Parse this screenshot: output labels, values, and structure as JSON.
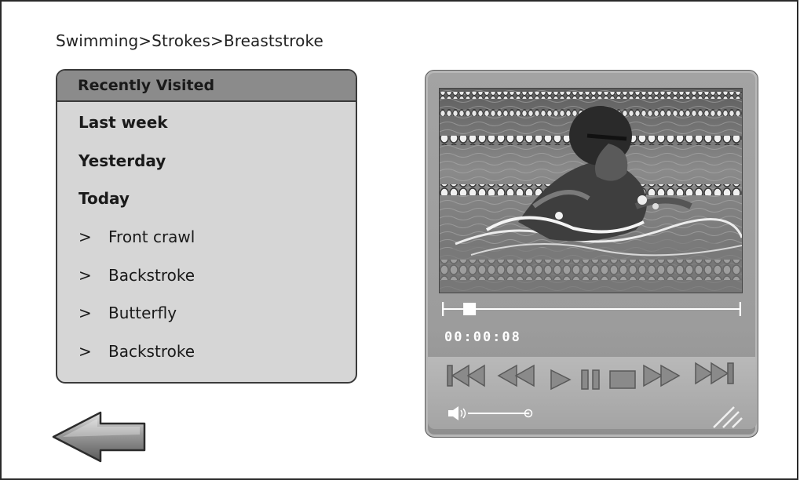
{
  "breadcrumb": "Swimming>Strokes>Breaststroke",
  "recent": {
    "header": "Recently Visited",
    "items": [
      {
        "label": "Last week",
        "bold": true,
        "chevron": ""
      },
      {
        "label": "Yesterday",
        "bold": true,
        "chevron": ""
      },
      {
        "label": "Today",
        "bold": true,
        "chevron": ""
      },
      {
        "label": "Front crawl",
        "bold": false,
        "chevron": ">"
      },
      {
        "label": "Backstroke",
        "bold": false,
        "chevron": ">"
      },
      {
        "label": "Butterfly",
        "bold": false,
        "chevron": ">"
      },
      {
        "label": "Backstroke",
        "bold": false,
        "chevron": ">"
      }
    ]
  },
  "player": {
    "timecode": "00:00:08",
    "progress": 0.09,
    "volume": 1.0,
    "controls": [
      "skip-back-icon",
      "rewind-icon",
      "play-icon",
      "pause-icon",
      "stop-icon",
      "fast-forward-icon",
      "skip-forward-icon"
    ]
  },
  "icons": {
    "back": "left-arrow-icon",
    "volume": "speaker-icon",
    "resize": "resize-grip-icon"
  }
}
